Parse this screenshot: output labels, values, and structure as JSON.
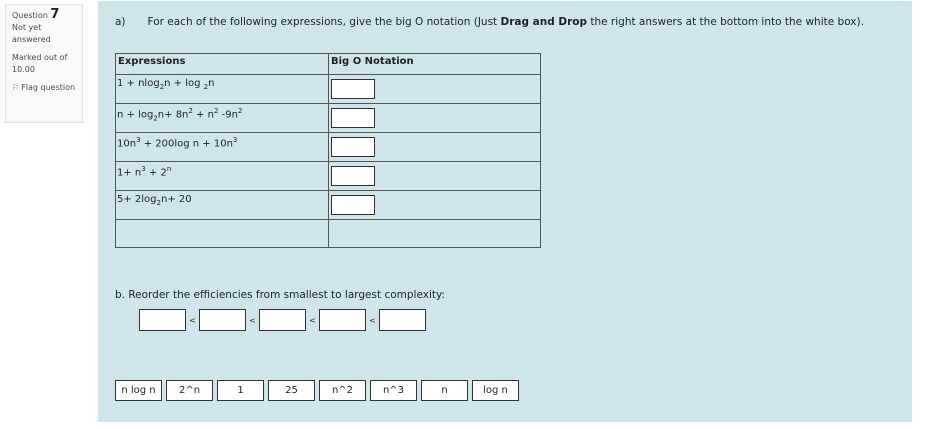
{
  "info": {
    "question_label": "Question",
    "question_number": "7",
    "status": "Not yet answered",
    "marks": "Marked out of 10.00",
    "flag_label": "Flag question",
    "flag_icon": "flag-icon"
  },
  "question": {
    "part_a_marker": "a)",
    "text_before": "For each of the following expressions, give the big O notation (Just ",
    "text_bold": "Drag and Drop",
    "text_after": " the right answers at the bottom into the white box).",
    "table_headers": [
      "Expressions",
      "Big O Notation"
    ],
    "part_b": "b. Reorder the efficiencies from smallest to largest complexity:",
    "less_than": "<"
  },
  "choices": [
    "n log n",
    "2^n",
    "1",
    "25",
    "n^2",
    "n^3",
    "n",
    "log n"
  ]
}
